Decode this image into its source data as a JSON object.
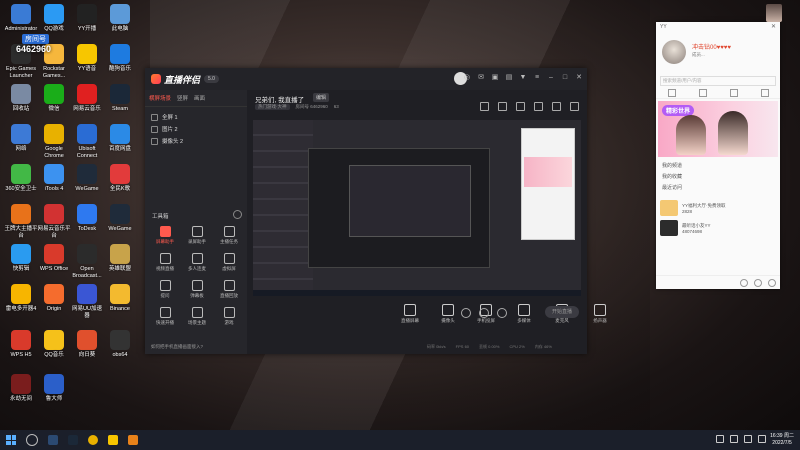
{
  "overlay": {
    "room_tag": "房间号",
    "room_id": "6462960"
  },
  "desktop_icons": [
    {
      "label": "Administrator",
      "color": "#3a7bd5"
    },
    {
      "label": "QQ游戏",
      "color": "#2b9af3"
    },
    {
      "label": "YY开播",
      "color": "#222"
    },
    {
      "label": "此电脑",
      "color": "#5c9ad8"
    },
    {
      "label": "Epic Games Launcher",
      "color": "#2d2d2d"
    },
    {
      "label": "Rockstar Games...",
      "color": "#f6b73c"
    },
    {
      "label": "YY语音",
      "color": "#f7c600"
    },
    {
      "label": "酷狗音乐",
      "color": "#1e7be0"
    },
    {
      "label": "回收站",
      "color": "#7a8aa3"
    },
    {
      "label": "微信",
      "color": "#1aad19"
    },
    {
      "label": "网易云音乐",
      "color": "#e02020"
    },
    {
      "label": "Steam",
      "color": "#1b2838"
    },
    {
      "label": "网络",
      "color": "#3d7ad6"
    },
    {
      "label": "Google Chrome",
      "color": "#e8b100"
    },
    {
      "label": "Ubisoft Connect",
      "color": "#2a6cd4"
    },
    {
      "label": "百度网盘",
      "color": "#2b8ae6"
    },
    {
      "label": "360安全卫士",
      "color": "#42b846"
    },
    {
      "label": "iTools 4",
      "color": "#3c92f0"
    },
    {
      "label": "WeGame",
      "color": "#1f2b3a"
    },
    {
      "label": "全民K歌",
      "color": "#e23b3b"
    },
    {
      "label": "王牌大主播平台",
      "color": "#e8721a"
    },
    {
      "label": "网易云音乐平台",
      "color": "#d23232"
    },
    {
      "label": "ToDesk",
      "color": "#2e79f0"
    },
    {
      "label": "WeGame",
      "color": "#1f2b3a"
    },
    {
      "label": "快剪辑",
      "color": "#2a9bf0"
    },
    {
      "label": "WPS Office",
      "color": "#d93a2b"
    },
    {
      "label": "Open Broadcast...",
      "color": "#2b2b2b"
    },
    {
      "label": "英雄联盟",
      "color": "#c8a34a"
    },
    {
      "label": "雷电多开器4",
      "color": "#f7b500"
    },
    {
      "label": "Origin",
      "color": "#f56c2d"
    },
    {
      "label": "网易UU加速器",
      "color": "#3a56d4"
    },
    {
      "label": "Binance",
      "color": "#f3ba2f"
    },
    {
      "label": "WPS H5",
      "color": "#d93a2b"
    },
    {
      "label": "QQ音乐",
      "color": "#f5c11a"
    },
    {
      "label": "向日葵",
      "color": "#e0502d"
    },
    {
      "label": "obs64",
      "color": "#333"
    },
    {
      "label": "永劫无间",
      "color": "#7a1d1d"
    },
    {
      "label": "鲁大师",
      "color": "#2b5fc9"
    }
  ],
  "app": {
    "logo": "直播伴侣",
    "version": "5.0",
    "scene_tabs": [
      "横屏场景",
      "竖屏",
      "画面"
    ],
    "scenes": [
      "全屏 1",
      "图片 2",
      "摄像头 2"
    ],
    "tools_title": "工具箱",
    "tools": [
      "屏幕助手",
      "录屏助手",
      "主播任务",
      "视频直播",
      "多人连麦",
      "虚拟屏",
      "提问",
      "弹幕板",
      "直播回放",
      "快速开播",
      "场景主题",
      "游戏"
    ],
    "footer_tip": "如何把手机直播画面接入?",
    "live_title": "兄弟们, 我直播了",
    "edit_label": "编辑",
    "category": "热门游戏·大神",
    "room_meta": "房间号 6462960",
    "likes": "63",
    "controls": [
      "直播屏幕",
      "摄像头",
      "手机投屏",
      "多媒体",
      "麦克风",
      "扬声器"
    ],
    "start_button": "开始直播",
    "stats": [
      "码率 0kb/s",
      "FPS 60",
      "丢帧 0.00%",
      "CPU 2%",
      "内存 46%"
    ]
  },
  "yy": {
    "title": "YY",
    "username": "冲击钻00♥♥♥♥",
    "subtitle": "成员...",
    "search_placeholder": "搜索频道/用户/内容",
    "banner_tag": "精彩世界",
    "menu": [
      "我的频道",
      "我的收藏",
      "最近访问"
    ],
    "items": [
      {
        "title": "YY福利大厅·免费领取",
        "sub": "2828"
      },
      {
        "title": "最听话小友YY",
        "sub": "48074698"
      }
    ]
  },
  "corner": {
    "label": "YY"
  },
  "taskbar": {
    "time": "16:39",
    "day": "周二",
    "date": "2022/7/5"
  }
}
